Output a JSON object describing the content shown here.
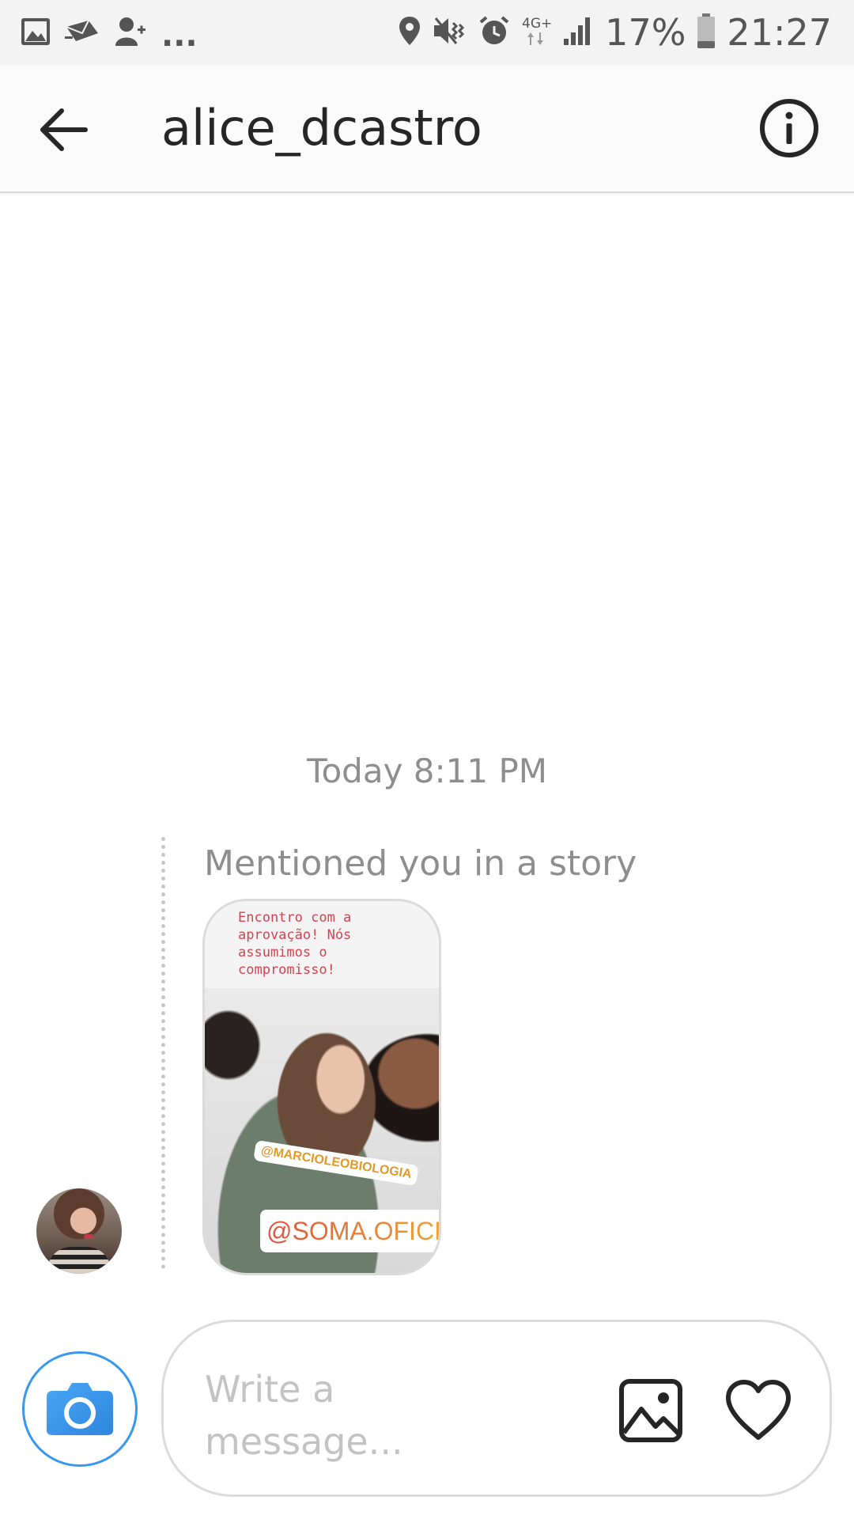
{
  "status_bar": {
    "overflow": "...",
    "battery": "17%",
    "time": "21:27",
    "network": "4G+",
    "icons": [
      "gallery-icon",
      "mail-icon",
      "add-user-icon",
      "location-icon",
      "mute-icon",
      "alarm-icon",
      "signal-icon",
      "battery-icon"
    ]
  },
  "header": {
    "title": "alice_dcastro",
    "back_icon": "arrow-left-icon",
    "info_icon": "info-icon"
  },
  "thread": {
    "timestamp": "Today 8:11 PM",
    "mention_caption": "Mentioned you in a story",
    "story": {
      "text": "Encontro com a\naprovação! Nós\nassumimos o\ncompromisso!",
      "sticker_1": "@MARCIOLEOBIOLOGIA",
      "sticker_2": "@SOMA.OFICIAL"
    }
  },
  "composer": {
    "placeholder": "Write a message...",
    "camera_icon": "camera-icon",
    "gallery_icon": "image-icon",
    "like_icon": "heart-icon"
  },
  "colors": {
    "accent": "#3897f0",
    "text": "#262626",
    "muted": "#8e8e8e",
    "border": "#dbdbdb"
  }
}
